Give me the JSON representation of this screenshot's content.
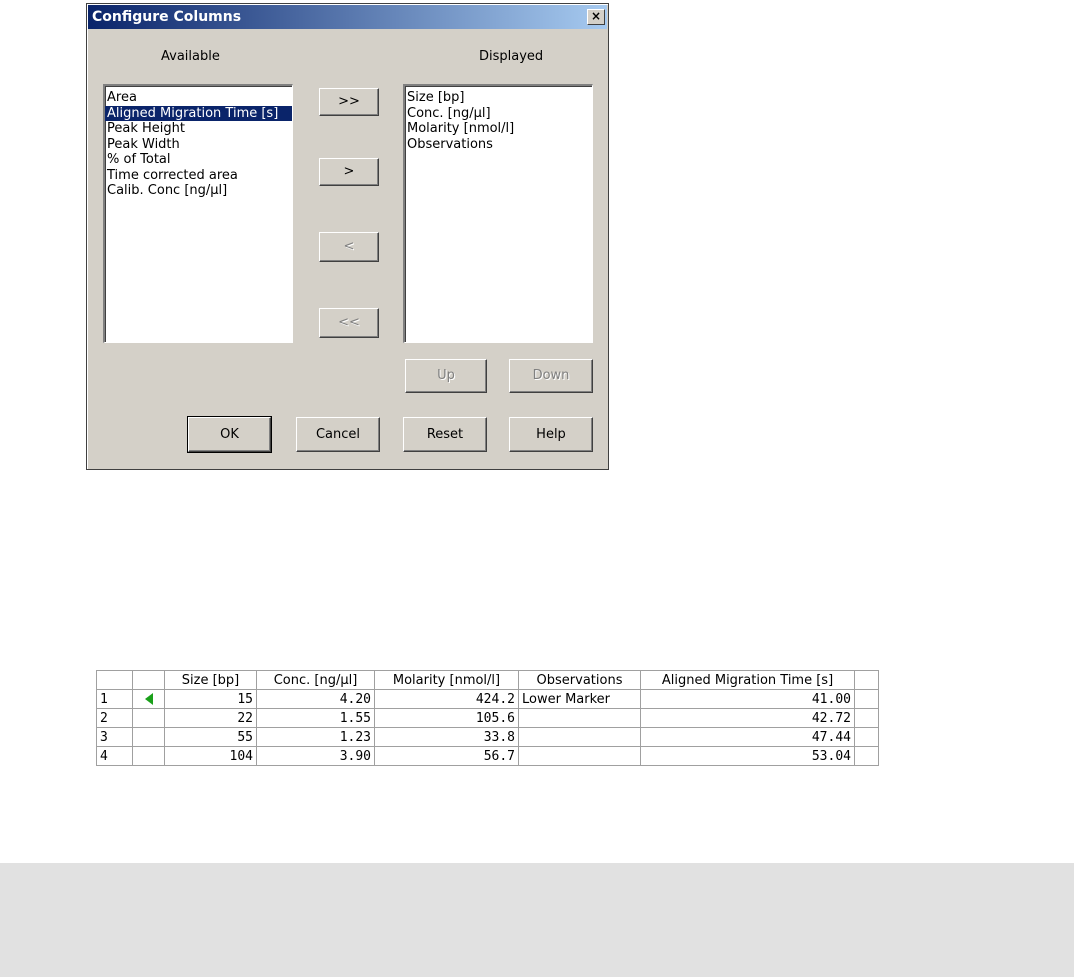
{
  "dialog": {
    "title": "Configure Columns",
    "close_label": "×",
    "available_label": "Available",
    "displayed_label": "Displayed",
    "available_items": [
      "Area",
      "Aligned Migration Time [s]",
      "Peak Height",
      "Peak Width",
      "% of Total",
      "Time corrected area",
      "Calib. Conc [ng/µl]"
    ],
    "available_selected_index": 1,
    "displayed_items": [
      "Size [bp]",
      "Conc. [ng/µl]",
      "Molarity [nmol/l]",
      "Observations"
    ],
    "buttons": {
      "add_all": ">>",
      "add": ">",
      "remove": "<",
      "remove_all": "<<",
      "up": "Up",
      "down": "Down",
      "ok": "OK",
      "cancel": "Cancel",
      "reset": "Reset",
      "help": "Help"
    }
  },
  "grid": {
    "headers": [
      "",
      "",
      "Size [bp]",
      "Conc. [ng/µl]",
      "Molarity [nmol/l]",
      "Observations",
      "Aligned Migration Time [s]",
      ""
    ],
    "rows": [
      {
        "num": "1",
        "marker": true,
        "size": "15",
        "conc": "4.20",
        "molarity": "424.2",
        "observations": "Lower Marker",
        "amt": "41.00"
      },
      {
        "num": "2",
        "marker": false,
        "size": "22",
        "conc": "1.55",
        "molarity": "105.6",
        "observations": "",
        "amt": "42.72"
      },
      {
        "num": "3",
        "marker": false,
        "size": "55",
        "conc": "1.23",
        "molarity": "33.8",
        "observations": "",
        "amt": "47.44"
      },
      {
        "num": "4",
        "marker": false,
        "size": "104",
        "conc": "3.90",
        "molarity": "56.7",
        "observations": "",
        "amt": "53.04"
      }
    ],
    "marker_color": "#1aa01a"
  }
}
